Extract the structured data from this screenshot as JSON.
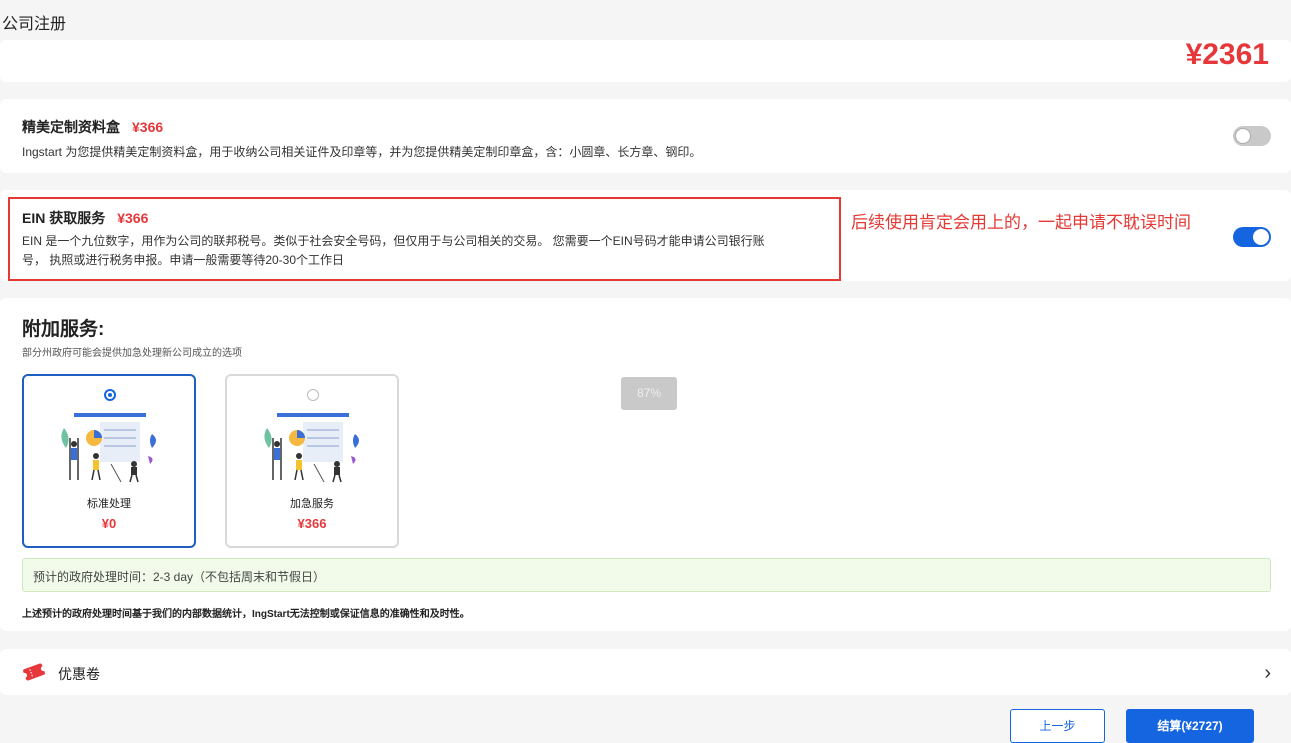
{
  "header": {
    "title": "公司注册"
  },
  "previous_total": {
    "price": "¥2361"
  },
  "services": [
    {
      "title": "精美定制资料盒",
      "price": "¥366",
      "description": "Ingstart 为您提供精美定制资料盒，用于收纳公司相关证件及印章等，并为您提供精美定制印章盒，含：小圆章、长方章、钢印。",
      "enabled": false
    },
    {
      "title": "EIN 获取服务",
      "price": "¥366",
      "description_line1": "EIN 是一个九位数字，用作为公司的联邦税号。类似于社会安全号码，但仅用于与公司相关的交易。 您需要一个EIN号码才能申请公司银行账",
      "description_line2": "号， 执照或进行税务申报。申请一般需要等待20-30个工作日",
      "enabled": true
    }
  ],
  "annotation": {
    "text": "后续使用肯定会用上的，一起申请不耽误时间",
    "color": "#e53935"
  },
  "addon": {
    "title": "附加服务:",
    "subtitle": "部分州政府可能会提供加急处理新公司成立的选项",
    "options": [
      {
        "name": "标准处理",
        "price": "¥0",
        "selected": true
      },
      {
        "name": "加急服务",
        "price": "¥366",
        "selected": false
      }
    ],
    "eta": "预计的政府处理时间：2-3 day（不包括周末和节假日）",
    "disclaimer": "上述预计的政府处理时间基于我们的内部数据统计，IngStart无法控制或保证信息的准确性和及时性。"
  },
  "zoom_badge": "87%",
  "coupon": {
    "label": "优惠卷",
    "icon": "coupon-ticket-icon"
  },
  "footer": {
    "prev_label": "上一步",
    "pay_label": "结算(¥2727)"
  },
  "colors": {
    "accent": "#1565e0",
    "price": "#e6373a",
    "highlight_border": "#e53935"
  }
}
